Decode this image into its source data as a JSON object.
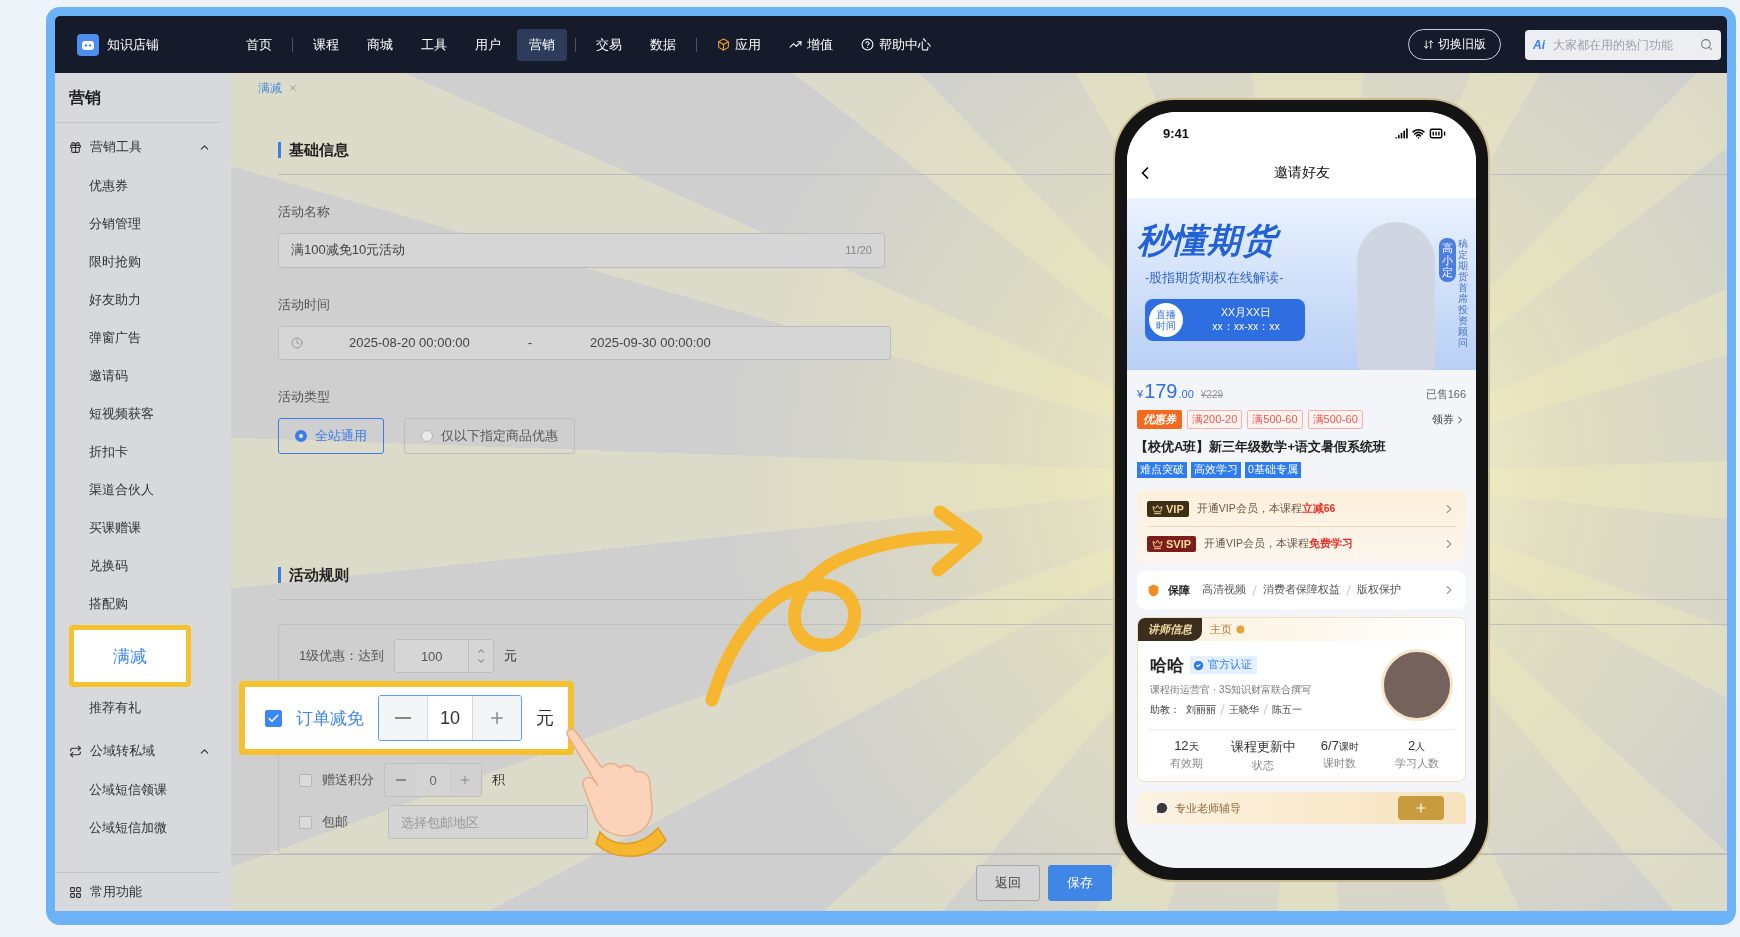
{
  "app": {
    "name": "知识店铺"
  },
  "nav": {
    "items": [
      {
        "label": "首页",
        "selected": false,
        "divider_before": false,
        "has_icon": false
      },
      {
        "label": "课程",
        "selected": false,
        "divider_before": true,
        "has_icon": false
      },
      {
        "label": "商城",
        "selected": false,
        "divider_before": false,
        "has_icon": false
      },
      {
        "label": "工具",
        "selected": false,
        "divider_before": false,
        "has_icon": false
      },
      {
        "label": "用户",
        "selected": false,
        "divider_before": false,
        "has_icon": false
      },
      {
        "label": "营销",
        "selected": true,
        "divider_before": false,
        "has_icon": false
      },
      {
        "label": "交易",
        "selected": false,
        "divider_before": true,
        "has_icon": false
      },
      {
        "label": "数据",
        "selected": false,
        "divider_before": false,
        "has_icon": false
      },
      {
        "label": "应用",
        "selected": false,
        "divider_before": true,
        "has_icon": true
      },
      {
        "label": "增值",
        "selected": false,
        "divider_before": false,
        "has_icon": true
      },
      {
        "label": "帮助中心",
        "selected": false,
        "divider_before": false,
        "has_icon": true
      }
    ],
    "switch_label": "切换旧版",
    "search": {
      "badge": "Ai",
      "placeholder": "大家都在用的热门功能"
    }
  },
  "sidebar": {
    "title": "营销",
    "groups": [
      {
        "label": "营销工具",
        "expanded": true,
        "items": [
          {
            "label": "优惠券",
            "selected": false
          },
          {
            "label": "分销管理",
            "selected": false
          },
          {
            "label": "限时抢购",
            "selected": false
          },
          {
            "label": "好友助力",
            "selected": false
          },
          {
            "label": "弹窗广告",
            "selected": false
          },
          {
            "label": "邀请码",
            "selected": false
          },
          {
            "label": "短视频获客",
            "selected": false
          },
          {
            "label": "折扣卡",
            "selected": false
          },
          {
            "label": "渠道合伙人",
            "selected": false
          },
          {
            "label": "买课赠课",
            "selected": false
          },
          {
            "label": "兑换码",
            "selected": false
          },
          {
            "label": "搭配购",
            "selected": false
          },
          {
            "label": "满减",
            "selected": true
          },
          {
            "label": "推荐有礼",
            "selected": false
          }
        ]
      },
      {
        "label": "公域转私域",
        "expanded": true,
        "items": [
          {
            "label": "公域短信领课",
            "selected": false
          },
          {
            "label": "公域短信加微",
            "selected": false
          }
        ]
      }
    ],
    "footer": "常用功能"
  },
  "breadcrumb": {
    "label": "满减"
  },
  "basic": {
    "heading": "基础信息",
    "name_label": "活动名称",
    "name_value": "满100减免10元活动",
    "name_counter": "11/20",
    "time_label": "活动时间",
    "start": "2025-08-20 00:00:00",
    "separator": "-",
    "end": "2025-09-30 00:00:00",
    "type_label": "活动类型",
    "types": [
      {
        "label": "全站通用",
        "selected": true
      },
      {
        "label": "仅以下指定商品优惠",
        "selected": false
      }
    ]
  },
  "rules": {
    "heading": "活动规则",
    "rows": [
      {
        "kind": "threshold",
        "highlighted": false,
        "label": "1级优惠：达到",
        "value": "100",
        "unit": "元"
      },
      {
        "kind": "stepper",
        "highlighted": true,
        "checked": true,
        "label": "订单减免",
        "value": "10",
        "unit": "元"
      },
      {
        "kind": "stepper",
        "highlighted": false,
        "checked": false,
        "label": "赠送积分",
        "value": "0",
        "unit": "积"
      },
      {
        "kind": "select",
        "highlighted": false,
        "checked": false,
        "label": "包邮",
        "placeholder": "选择包邮地区"
      }
    ]
  },
  "footer_buttons": [
    {
      "label": "返回",
      "kind": "default"
    },
    {
      "label": "保存",
      "kind": "primary"
    }
  ],
  "phone": {
    "time": "9:41",
    "title": "邀请好友",
    "banner": {
      "headline": "秒懂期货",
      "subtitle": "-股指期货期权在线解读-",
      "live_label": "直播时间",
      "date": "XX月XX日",
      "time_range": "xx：xx-xx：xx",
      "host_name": "高小定",
      "host_title": "稿定期货首席投资顾问"
    },
    "price": {
      "currency": "¥",
      "integer": "179",
      "decimal": ".00",
      "original": "¥229",
      "sold": "已售166"
    },
    "coupons": {
      "label": "优惠券",
      "items": [
        "满200-20",
        "满500-60",
        "满500-60"
      ],
      "action": "领券"
    },
    "course_title": "【校优A班】新三年级数学+语文暑假系统班",
    "tags": [
      "难点突破",
      "高效学习",
      "0基础专属"
    ],
    "memberships": [
      {
        "kind": "vip",
        "badge": "VIP",
        "text": "开通VIP会员，本课程**立减66**"
      },
      {
        "kind": "svip",
        "badge": "SVIP",
        "text": "开通VIP会员，本课程**免费学习**"
      }
    ],
    "guarantee": {
      "label": "保障",
      "items": [
        "高清视频",
        "消费者保障权益",
        "版权保护"
      ]
    },
    "teacher": {
      "tab": "讲师信息",
      "home": "主页",
      "name": "哈哈",
      "verified": "官方认证",
      "bio": "课程街运营官 · 3S知识财富联合撰写",
      "assistant_label": "助教：",
      "assistants": [
        "刘丽丽",
        "王晓华",
        "陈五一"
      ],
      "stats": [
        {
          "value": "12",
          "unit": "天",
          "label": "有效期"
        },
        {
          "value": "课程更新中",
          "label": "状态"
        },
        {
          "value": "6/7",
          "unit": "课时",
          "label": "课时数"
        },
        {
          "value": "2",
          "unit": "人",
          "label": "学习人数"
        }
      ]
    },
    "consult": {
      "label": "专业老师辅导"
    }
  }
}
